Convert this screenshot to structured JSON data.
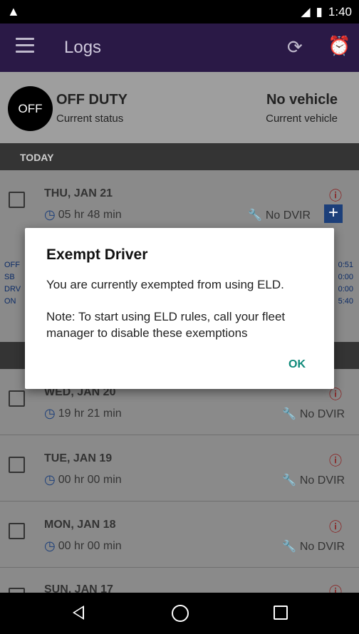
{
  "status_bar": {
    "time": "1:40",
    "network": "᠋LTE"
  },
  "app_bar": {
    "title": "Logs"
  },
  "status_card": {
    "badge": "OFF",
    "status": "OFF DUTY",
    "status_caption": "Current status",
    "vehicle": "No vehicle",
    "vehicle_caption": "Current vehicle"
  },
  "section_today": "TODAY",
  "logs": [
    {
      "date": "THU, JAN 21",
      "duration": "05 hr  48 min",
      "dvir": "No DVIR"
    },
    {
      "date": "WED, JAN 20",
      "duration": "19 hr  21 min",
      "dvir": "No DVIR"
    },
    {
      "date": "TUE, JAN 19",
      "duration": "00 hr  00 min",
      "dvir": "No DVIR"
    },
    {
      "date": "MON, JAN 18",
      "duration": "00 hr  00 min",
      "dvir": "No DVIR"
    },
    {
      "date": "SUN, JAN 17"
    }
  ],
  "summary_left": [
    "OFF",
    "SB",
    "DRV",
    "ON"
  ],
  "summary_right": [
    "0:51",
    "0:00",
    "0:00",
    "5:40"
  ],
  "dialog": {
    "title": "Exempt Driver",
    "message": "You are currently exempted from using ELD.",
    "note": "Note: To start using ELD rules, call your fleet manager to disable these exemptions",
    "ok": "OK"
  }
}
